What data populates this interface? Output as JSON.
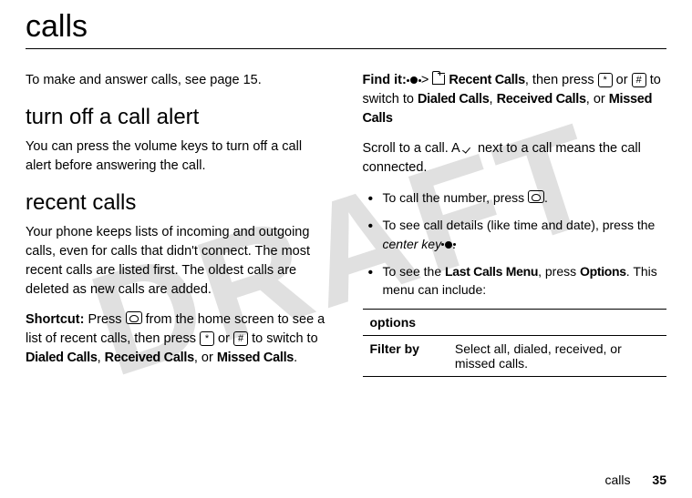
{
  "watermark": "DRAFT",
  "title": "calls",
  "left": {
    "intro_a": "To make and answer calls, see page ",
    "intro_page": "15",
    "intro_b": ".",
    "sect1_title": "turn off a call alert",
    "sect1_body": "You can press the volume keys to turn off a call alert before answering the call.",
    "sect2_title": "recent calls",
    "sect2_body": "Your phone keeps lists of incoming and outgoing calls, even for calls that didn't connect. The most recent calls are listed first. The oldest calls are deleted as new calls are added.",
    "shortcut_label": "Shortcut:",
    "shortcut_a": " Press ",
    "shortcut_b": " from the home screen to see a list of recent calls, then press ",
    "shortcut_c": " or ",
    "shortcut_d": " to switch to ",
    "dialed": "Dialed Calls",
    "received": "Received Calls",
    "missed": "Missed Calls",
    "comma": ", ",
    "or": "or ",
    "period": "."
  },
  "right": {
    "findit_label": "Find it:",
    "findit_a": " ",
    "findit_b": " > ",
    "recent_calls": "Recent Calls",
    "findit_c": ", then press ",
    "findit_d": " or ",
    "findit_e": " to switch to ",
    "dialed": "Dialed Calls",
    "received": "Received Calls",
    "missed": "Missed Calls",
    "comma": ", ",
    "or": "or ",
    "scroll_a": "Scroll to a call. A ",
    "scroll_b": " next to a call means the call connected.",
    "bullet1_a": "To call the number, press ",
    "bullet1_b": ".",
    "bullet2_a": "To see call details (like time and date), press the ",
    "bullet2_key": "center key",
    "bullet2_b": " ",
    "bullet2_c": ".",
    "bullet3_a": "To see the ",
    "bullet3_menu": "Last Calls Menu",
    "bullet3_b": ", press ",
    "bullet3_opt": "Options",
    "bullet3_c": ". This menu can include:",
    "table_header": "options",
    "row1_label": "Filter by",
    "row1_val": "Select all, dialed, received, or missed calls."
  },
  "keys": {
    "star": "*",
    "hash": "#"
  },
  "footer": {
    "section": "calls",
    "page": "35"
  }
}
